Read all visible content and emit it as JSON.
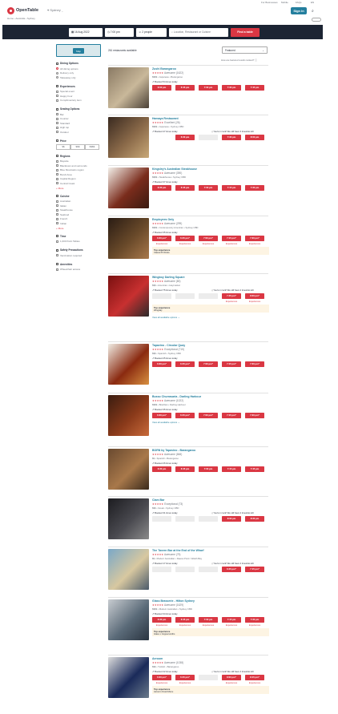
{
  "header": {
    "brand": "OpenTable",
    "location": "Sydney",
    "sign_in": "Sign in",
    "utility": [
      "For Businesses",
      "Mobile",
      "FAQs",
      "EN"
    ],
    "breadcrumb": "Home › Australia › Sydney"
  },
  "search": {
    "date": "16 Aug 2022",
    "time": "7:00 pm",
    "people": "2 people",
    "query_placeholder": "Location, Restaurant or Cuisine",
    "find_label": "Find a table"
  },
  "sidebar": {
    "map_label": "Map",
    "dining": {
      "title": "Dining Options",
      "items": [
        "All dining options",
        "Delivery only",
        "Takeaway only"
      ]
    },
    "experiences": {
      "title": "Experiences",
      "items": [
        "Special event",
        "Happy hour",
        "Complimentary item"
      ]
    },
    "seating": {
      "title": "Seating Options",
      "items": [
        "Bar",
        "Counter",
        "Standard",
        "High top",
        "Outdoor"
      ]
    },
    "price": {
      "title": "Price",
      "items": [
        "$$",
        "$$$",
        "$$$$"
      ]
    },
    "regions": {
      "title": "Regions",
      "items": [
        "Bayside",
        "Blacktown and surrounds",
        "Blue Mountains region",
        "Bondi Area",
        "Capital Region",
        "Central Coast"
      ],
      "more": "+ More"
    },
    "cuisine": {
      "title": "Cuisine",
      "items": [
        "Australian",
        "Italian",
        "Steakhouse",
        "Seafood",
        "French",
        "Indian"
      ],
      "more": "+ More"
    },
    "time": {
      "title": "Time",
      "items": [
        "1,000 Point Tables"
      ]
    },
    "safety": {
      "title": "Safety Precautions",
      "items": [
        "Vaccination required"
      ]
    },
    "amenities": {
      "title": "Amenities",
      "items": [
        "Wheelchair access"
      ]
    }
  },
  "results": {
    "count": "261 restaurants available",
    "sort": "Featured",
    "sort_note": "How are featured results ranked?"
  },
  "restaurants": [
    {
      "name": "Zushi Barangaroo",
      "rating": "Awesome (1622)",
      "meta": "$$$$ • Japanese • Barangaroo",
      "booked": "Booked 54 times today",
      "note": "",
      "slots": [
        "6:00 pm",
        "6:45 pm",
        "7:00 pm",
        "7:30 pm",
        "7:45 pm"
      ]
    },
    {
      "name": "Hamaya Restaurant",
      "rating": "Excellent (26)",
      "meta": "$$$$ • Japanese • Sydney CBD",
      "booked": "Booked 47 times today",
      "note": "You're in luck! We still have 3 timeslots left",
      "slots": [
        "",
        "",
        "6:30 pm",
        "",
        "7:30 pm",
        "8:00 pm"
      ]
    },
    {
      "name": "Kingsley's Australian Steakhouse",
      "rating": "Awesome (390)",
      "meta": "$$$$ • Steakhouse • Sydney CBD",
      "booked": "Booked 37 times today",
      "note": "",
      "slots": [
        "6:30 pm",
        "6:45 pm",
        "7:00 pm",
        "7:15 pm",
        "7:30 pm"
      ]
    },
    {
      "name": "Employees Only",
      "rating": "Awesome (299)",
      "meta": "$$$$ • Contemporary American • Sydney CBD",
      "booked": "Booked 35 times today",
      "note": "",
      "slots": [
        "6:30 pm*",
        "6:45 pm*",
        "7:00 pm*",
        "7:15 pm*",
        "7:30 pm*"
      ],
      "exp": [
        "Experiences",
        "Experiences",
        "Experiences",
        "Experiences",
        "Experiences"
      ],
      "top": "Top experience",
      "topsub": "Classic B Drinks"
    },
    {
      "name": "Wingboy Darling Square",
      "rating": "Awesome (80)",
      "meta": "$$$ • American • Haymarket",
      "booked": "Booked 75 times today",
      "note": "You're in luck! We still have 2 timeslots left",
      "slots": [
        "",
        "",
        "",
        "7:45 pm*",
        "8:00 pm*"
      ],
      "exp": [
        "",
        "",
        "",
        "Experiences",
        "Experiences"
      ],
      "top": "Top experience",
      "topsub": "Wingday",
      "view": "View all available options"
    },
    {
      "name": "Tapavino - Circular Quay",
      "rating": "Exceptional (715)",
      "meta": "$$$ • Spanish • Sydney CBD",
      "booked": "Booked 25 times today",
      "note": "",
      "slots": [
        "6:30 pm*",
        "6:45 pm*",
        "7:00 pm*",
        "7:15 pm*",
        "7:30 pm*"
      ]
    },
    {
      "name": "Busso Churrasaria - Darling Harbour",
      "rating": "Awesome (1022)",
      "meta": "$$$$ • Brazilian • Darling Harbour",
      "booked": "Booked 35 times today",
      "note": "",
      "slots": [
        "6:30 pm*",
        "6:45 pm*",
        "7:00 pm*",
        "7:15 pm*",
        "7:30 pm*"
      ],
      "view": "View all available options"
    },
    {
      "name": "BORN by Tapavino - Barangaroo",
      "rating": "Awesome (848)",
      "meta": "$$ • Spanish • Barangaroo",
      "booked": "Booked 26 times today",
      "note": "",
      "slots": [
        "6:30 pm",
        "6:45 pm",
        "7:00 pm",
        "7:15 pm",
        "7:45 pm"
      ]
    },
    {
      "name": "Clam Bar",
      "rating": "Exceptional (73)",
      "meta": "$$$ • Greek • Sydney CBD",
      "booked": "Booked 31 times today",
      "note": "You're in luck! We still have 2 timeslots left",
      "slots": [
        "",
        "",
        "",
        "8:00 pm",
        "8:30 pm"
      ]
    },
    {
      "name": "The Tavern Bar at the End of the Wharf",
      "rating": "Awesome (75)",
      "meta": "$$ • Modern Australian • Dawes Point / Walsh Bay",
      "booked": "Booked 17 times today",
      "note": "You're in luck! We still have 2 timeslots left",
      "slots": [
        "",
        "",
        "",
        "6:45 pm*",
        "7:15 pm*"
      ]
    },
    {
      "name": "Glass Brasserie - Hilton Sydney",
      "rating": "Awesome (1629)",
      "meta": "$$$$ • Modern Australian • Sydney CBD",
      "booked": "Booked 34 times today",
      "note": "",
      "slots": [
        "6:30 pm",
        "6:45 pm",
        "7:00 pm",
        "7:15 pm",
        "7:30 pm"
      ],
      "exp": [
        "Experiences",
        "Experiences",
        "Experiences",
        "Experiences",
        "Experiences"
      ],
      "top": "Top experience",
      "topsub": "Glass x Coppersmiths"
    },
    {
      "name": "Aeroom",
      "rating": "Awesome (1038)",
      "meta": "$$$ • Turkish • Barangaroo",
      "booked": "Booked 22 times today",
      "note": "You're in luck! We still have 4 timeslots left",
      "slots": [
        "6:30 pm*",
        "6:45 pm*",
        "",
        "8:00 pm*",
        "8:15 pm*"
      ],
      "exp": [
        "Experiences",
        "Experiences",
        "",
        "Experiences",
        "Experiences"
      ],
      "top": "Top experience",
      "topsub": "Aeroom Fixed Menu"
    }
  ]
}
